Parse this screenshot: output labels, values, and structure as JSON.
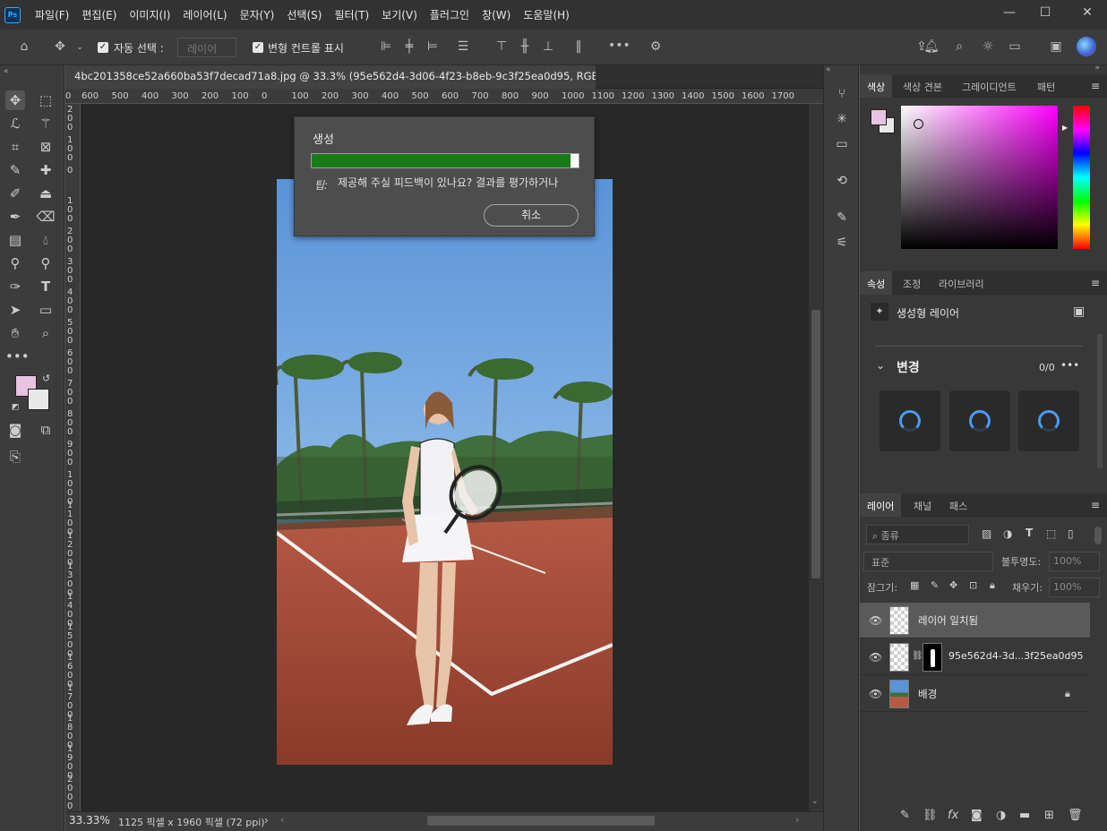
{
  "app": {
    "logo": "Ps"
  },
  "menubar": {
    "items": [
      "파일(F)",
      "편집(E)",
      "이미지(I)",
      "레이어(L)",
      "문자(Y)",
      "선택(S)",
      "필터(T)",
      "보기(V)",
      "플러그인",
      "창(W)",
      "도움말(H)"
    ]
  },
  "window_controls": {
    "minimize": "—",
    "maximize": "☐",
    "close": "✕"
  },
  "options_bar": {
    "auto_select_label": "자동 선택 :",
    "auto_select_checked": true,
    "auto_select_target": "레이어",
    "transform_controls_label": "변형 컨트롤 표시",
    "transform_controls_checked": true,
    "more_label": "•••"
  },
  "document": {
    "tab_title": "4bc201358ce52a660ba53f7decad71a8.jpg @ 33.3% (95e562d4-3d06-4f23-b8eb-9c3f25ea0d95, RGB/8*) *",
    "tab_close": "×",
    "ruler_top_ticks": [
      "0",
      "600",
      "500",
      "400",
      "300",
      "200",
      "100",
      "0",
      "100",
      "200",
      "300",
      "400",
      "500",
      "600",
      "700",
      "800",
      "900",
      "1000",
      "1100",
      "1200",
      "1300",
      "1400",
      "1500",
      "1600",
      "1700"
    ],
    "ruler_left_ticks": [
      "200",
      "100",
      "0",
      "100",
      "200",
      "300",
      "400",
      "500",
      "600",
      "700",
      "800",
      "900",
      "1000",
      "1100",
      "1200",
      "1300",
      "1400",
      "1500",
      "1600",
      "1700",
      "1800",
      "1900",
      "2000"
    ]
  },
  "generate_dialog": {
    "title": "생성",
    "progress": 0.97,
    "feedback_prefix": "팁:",
    "feedback_text": "제공해 주실 피드백이 있나요? 결과를 평가하거나",
    "cancel_label": "취소"
  },
  "statusbar": {
    "zoom": "33.33%",
    "doc_info": "1125 픽셀 x 1960 픽셀 (72 ppi)",
    "arrow": "›"
  },
  "color_panel": {
    "tabs": [
      "색상",
      "색상 견본",
      "그레이디언트",
      "패턴"
    ],
    "active_tab": "색상",
    "foreground_color": "#e6c3e0",
    "background_color": "#e8e8e8",
    "hue_color": "#ff00ff"
  },
  "properties_panel": {
    "tabs": [
      "속성",
      "조정",
      "라이브러리"
    ],
    "active_tab": "속성",
    "layer_type": "생성형 레이어",
    "variations_heading": "변경",
    "variations_count": "0/0",
    "more_label": "•••"
  },
  "layers_panel": {
    "tabs": [
      "레이어",
      "채널",
      "패스"
    ],
    "active_tab": "레이어",
    "filter_placeholder": "종류",
    "blend_mode": "표준",
    "opacity_label": "불투명도:",
    "opacity_value": "100%",
    "lock_label": "잠그기:",
    "fill_label": "채우기:",
    "fill_value": "100%",
    "layers": [
      {
        "name": "레이어 일치됨",
        "selected": true
      },
      {
        "name": "95e562d4-3d...3f25ea0d95",
        "selected": false
      },
      {
        "name": "배경",
        "selected": false
      }
    ]
  },
  "toolbar": {
    "foreground_color": "#e6c3e0",
    "background_color": "#e8e8e8"
  }
}
